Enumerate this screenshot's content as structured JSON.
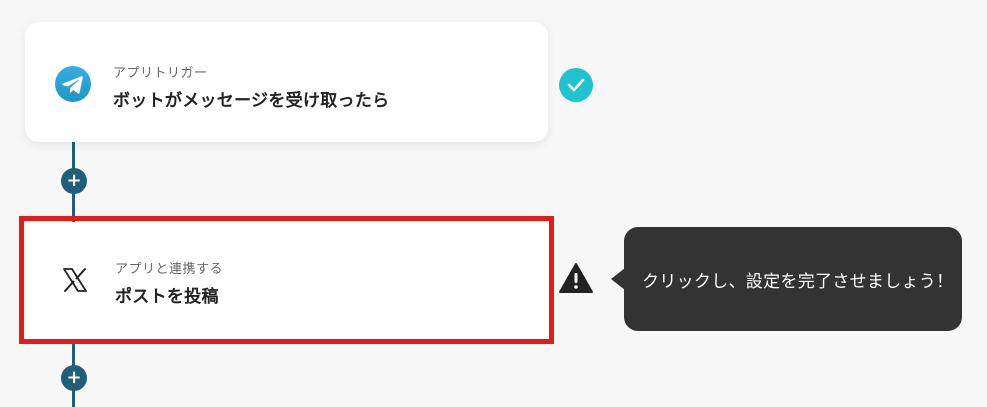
{
  "flow": {
    "trigger": {
      "app_icon": "telegram-icon",
      "subtitle": "アプリトリガー",
      "title": "ボットがメッセージを受け取ったら",
      "status_icon": "check-icon",
      "status_color": "#20c4cf"
    },
    "action": {
      "app_icon": "x-logo-icon",
      "subtitle": "アプリと連携する",
      "title": "ポストを投稿",
      "status_icon": "warning-icon",
      "highlight_color": "#e31b1b"
    },
    "add_step_label": "+",
    "tooltip": {
      "text": "クリックし、設定を完了させましょう！"
    }
  },
  "colors": {
    "connector": "#1f5f77",
    "background": "#f7f7f7",
    "tooltip_bg": "#333333"
  }
}
